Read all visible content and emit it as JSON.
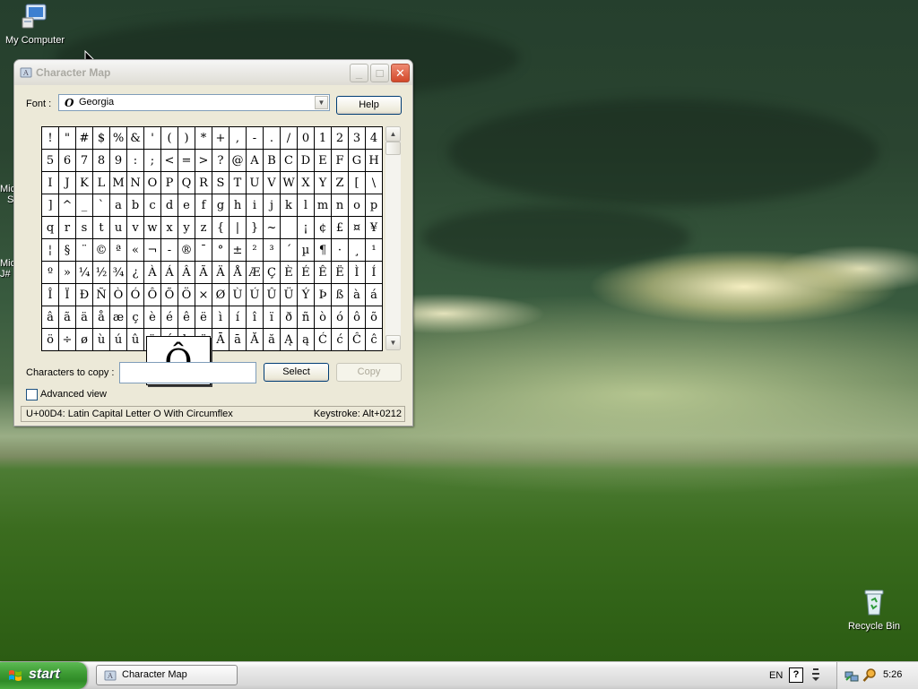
{
  "desktop": {
    "icons": {
      "my_computer": "My Computer",
      "recycle_bin": "Recycle Bin",
      "partial_1a": "Mic",
      "partial_1b": "S",
      "partial_2a": "Mic",
      "partial_2b": "J#"
    }
  },
  "window": {
    "title": "Character Map",
    "controls": {
      "minimize": "_",
      "maximize": "□",
      "close": "✕"
    },
    "font_label": "Font :",
    "font_glyph": "O",
    "font_value": "Georgia",
    "help_button": "Help",
    "grid_rows": [
      [
        "!",
        "\"",
        "#",
        "$",
        "%",
        "&",
        "'",
        "(",
        ")",
        "*",
        "+",
        ",",
        "-",
        ".",
        "/",
        "0",
        "1",
        "2",
        "3",
        "4"
      ],
      [
        "5",
        "6",
        "7",
        "8",
        "9",
        ":",
        ";",
        "<",
        "=",
        ">",
        "?",
        "@",
        "A",
        "B",
        "C",
        "D",
        "E",
        "F",
        "G",
        "H"
      ],
      [
        "I",
        "J",
        "K",
        "L",
        "M",
        "N",
        "O",
        "P",
        "Q",
        "R",
        "S",
        "T",
        "U",
        "V",
        "W",
        "X",
        "Y",
        "Z",
        "[",
        "\\"
      ],
      [
        "]",
        "^",
        "_",
        "`",
        "a",
        "b",
        "c",
        "d",
        "e",
        "f",
        "g",
        "h",
        "i",
        "j",
        "k",
        "l",
        "m",
        "n",
        "o",
        "p"
      ],
      [
        "q",
        "r",
        "s",
        "t",
        "u",
        "v",
        "w",
        "x",
        "y",
        "z",
        "{",
        "|",
        "}",
        "~",
        " ",
        "¡",
        "¢",
        "£",
        "¤",
        "¥"
      ],
      [
        "¦",
        "§",
        "¨",
        "©",
        "ª",
        "«",
        "¬",
        "-",
        "®",
        "¯",
        "°",
        "±",
        "²",
        "³",
        "´",
        "µ",
        "¶",
        "·",
        "¸",
        "¹"
      ],
      [
        "º",
        "»",
        "¼",
        "½",
        "¾",
        "¿",
        "À",
        "Á",
        "Â",
        "Ã",
        "Ä",
        "Å",
        "Æ",
        "Ç",
        "È",
        "É",
        "Ê",
        "Ë",
        "Ì",
        "Í"
      ],
      [
        "Î",
        "Ï",
        "Ð",
        "Ñ",
        "Ò",
        "Ó",
        "Ô",
        "Õ",
        "Ö",
        "×",
        "Ø",
        "Ù",
        "Ú",
        "Û",
        "Ü",
        "Ý",
        "Þ",
        "ß",
        "à",
        "á"
      ],
      [
        "â",
        "ã",
        "ä",
        "å",
        "æ",
        "ç",
        "è",
        "é",
        "ê",
        "ë",
        "ì",
        "í",
        "î",
        "ï",
        "ð",
        "ñ",
        "ò",
        "ó",
        "ô",
        "õ"
      ],
      [
        "ö",
        "÷",
        "ø",
        "ù",
        "ú",
        "û",
        "ü",
        "ý",
        "þ",
        "ÿ",
        "Ā",
        "ā",
        "Ă",
        "ă",
        "Ą",
        "ą",
        "Ć",
        "ć",
        "Ĉ",
        "ĉ"
      ]
    ],
    "selected_char": "Ô",
    "copy_label": "Characters to copy :",
    "copy_value": "",
    "select_button": "Select",
    "copy_button": "Copy",
    "advanced_view_label": "Advanced view",
    "advanced_view_checked": false,
    "status_left": "U+00D4: Latin Capital Letter O With Circumflex",
    "status_right": "Keystroke: Alt+0212"
  },
  "taskbar": {
    "start_label": "start",
    "task_label": "Character Map",
    "language": "EN",
    "help_icon": "?",
    "clock": "5:26"
  },
  "icons": {
    "my_computer": "computer-icon",
    "recycle_bin": "recycle-bin-icon",
    "app": "character-map-icon",
    "start_flag": "windows-flag-icon"
  }
}
